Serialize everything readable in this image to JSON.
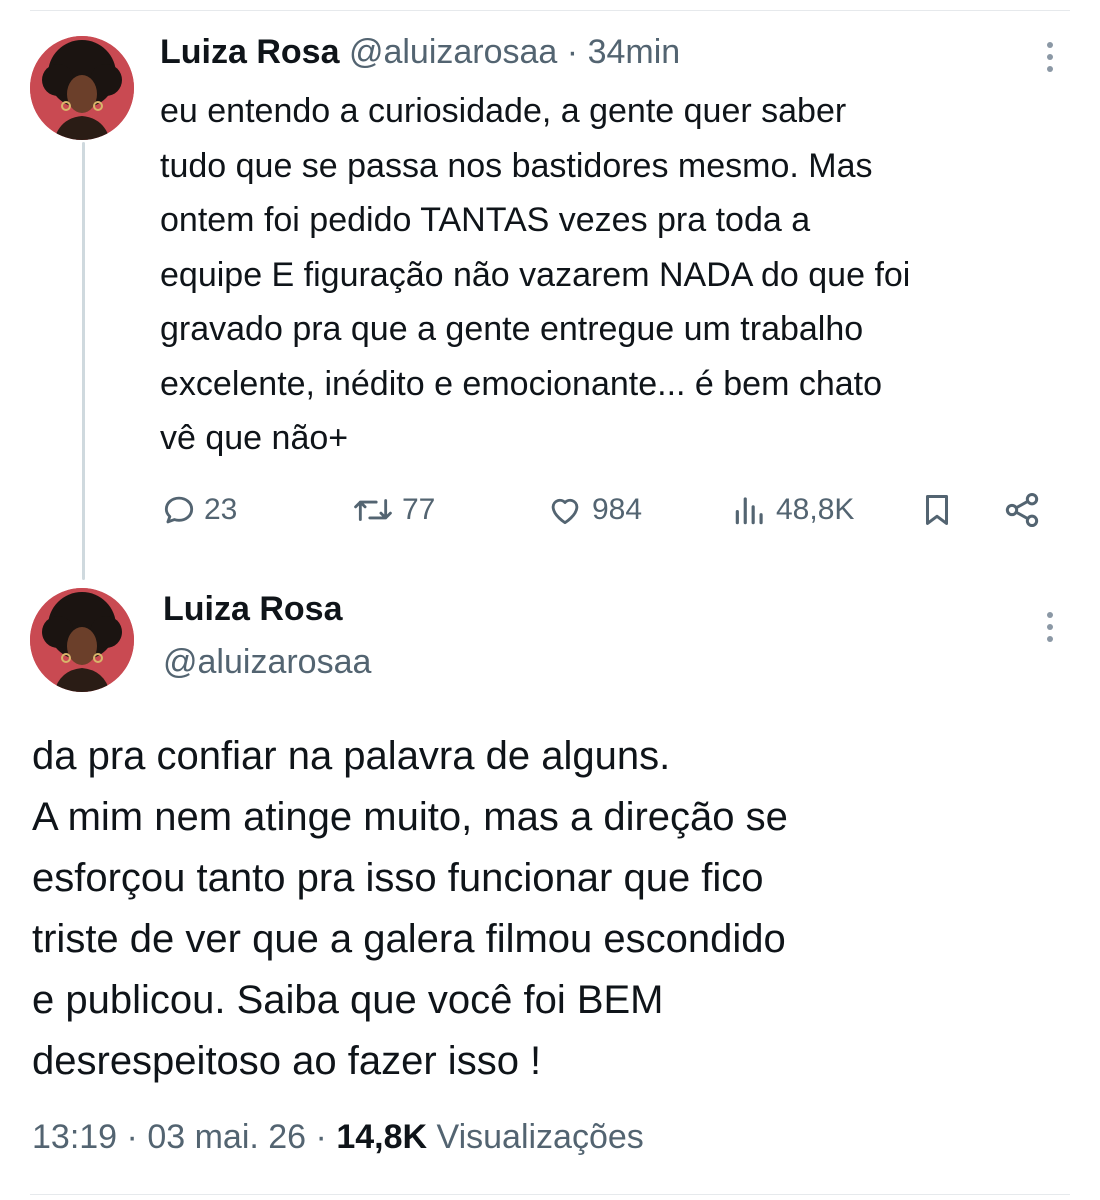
{
  "tweet1": {
    "author_name": "Luiza Rosa",
    "handle": "@aluizarosaa",
    "separator": "·",
    "time": "34min",
    "text": "eu entendo a curiosidade, a gente quer saber\ntudo que se passa nos bastidores mesmo. Mas\nontem foi pedido TANTAS vezes pra toda a\nequipe E figuração não vazarem NADA do que foi\ngravado pra que a gente entregue um trabalho\nexcelente, inédito e emocionante... é bem chato\nvê que não+",
    "actions": {
      "replies": "23",
      "reposts": "77",
      "likes": "984",
      "views": "48,8K"
    }
  },
  "tweet2": {
    "author_name": "Luiza Rosa",
    "handle": "@aluizarosaa",
    "text": "da pra confiar na palavra de alguns.\nA mim nem atinge muito, mas a direção se\nesforçou tanto pra isso funcionar que fico\ntriste de ver que a galera filmou escondido\ne publicou. Saiba que você foi BEM\ndesrespeitoso ao fazer isso !",
    "time": "13:19",
    "date": "03 mai. 26",
    "separator": "·",
    "views_count": "14,8K",
    "views_label": "Visualizações"
  },
  "icons": {
    "more": "more-vertical-icon",
    "reply": "reply-icon",
    "repost": "repost-icon",
    "like": "heart-icon",
    "views": "views-chart-icon",
    "bookmark": "bookmark-icon",
    "share": "share-icon"
  },
  "colors": {
    "text": "#0f1419",
    "muted": "#536471",
    "avatar_bg": "#c94a52",
    "thread_line": "#cfd9de"
  }
}
